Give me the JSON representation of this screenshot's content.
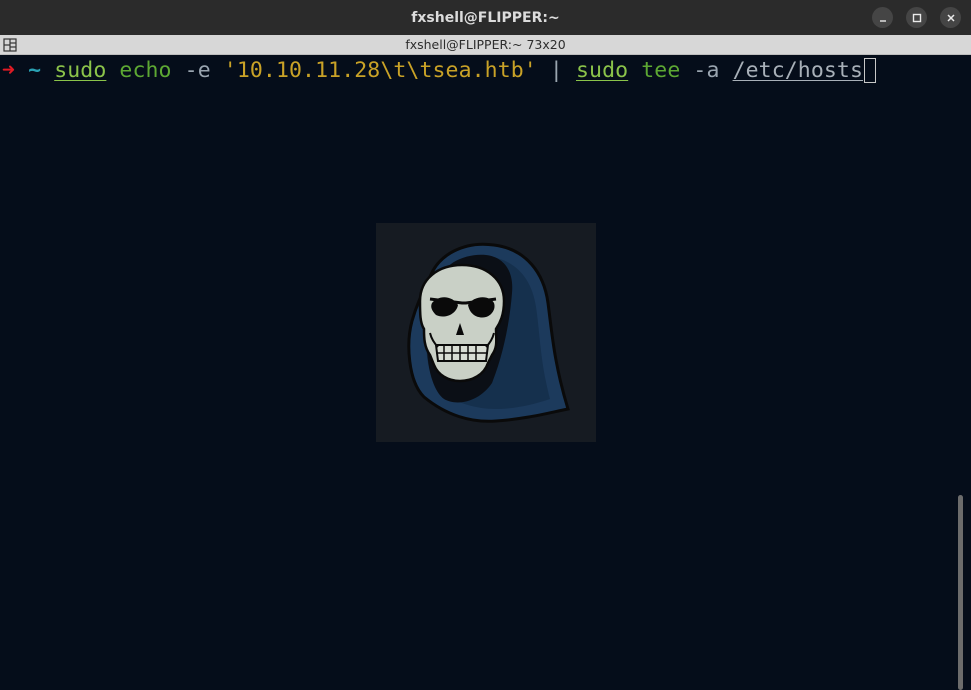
{
  "window": {
    "title": "fxshell@FLIPPER:~",
    "minimize_icon": "minimize-icon",
    "maximize_icon": "maximize-icon",
    "close_icon": "close-icon"
  },
  "tabbar": {
    "title": "fxshell@FLIPPER:~ 73x20",
    "split_icon": "split-view-icon"
  },
  "terminal": {
    "prompt_arrow": "➜",
    "prompt_dir": "~",
    "command": {
      "sudo1": "sudo",
      "echo": "echo",
      "flag_e": "-e",
      "string": "'10.10.11.28\\t\\tsea.htb'",
      "pipe": "|",
      "sudo2": "sudo",
      "tee": "tee",
      "flag_a": "-a",
      "path": "/etc/hosts"
    },
    "logo_icon": "hooded-skull-logo-icon",
    "colors": {
      "background": "#050d1a",
      "prompt_arrow": "#e01b24",
      "prompt_dir": "#2aa1b3",
      "command": "#5da833",
      "string": "#c9a227"
    }
  }
}
